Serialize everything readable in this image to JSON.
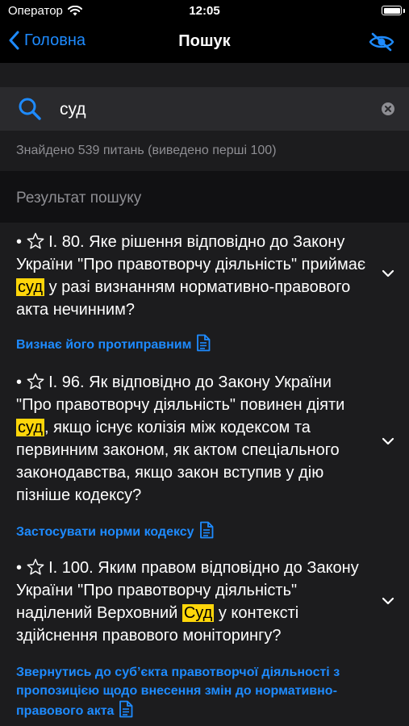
{
  "status": {
    "carrier": "Оператор",
    "time": "12:05"
  },
  "nav": {
    "back_label": "Головна",
    "title": "Пошук"
  },
  "search": {
    "value": "суд"
  },
  "info": {
    "found_text": "Знайдено 539 питань (виведено перші 100)"
  },
  "section": {
    "title": "Результат пошуку"
  },
  "colors": {
    "accent": "#1e8bff",
    "highlight": "#ffd60a",
    "background": "#1c1c1e"
  },
  "results": [
    {
      "prefix": "І. 80. Яке рішення відповідно до Закону України \"Про правотворчу діяльність\" приймає",
      "highlight": "суд",
      "suffix": "у разі визнанням нормативно-правового акта нечинним?",
      "answer": "Визнає його протиправним"
    },
    {
      "prefix": "І. 96. Як відповідно до Закону України \"Про правотворчу діяльність\" повинен діяти",
      "highlight": "суд",
      "suffix": ", якщо існує колізія між кодексом та первинним законом, як актом спеціального законодавства, якщо закон вступив у дію пізніше кодексу?",
      "answer": "Застосувати норми кодексу"
    },
    {
      "prefix": "І. 100. Яким правом відповідно до Закону України \"Про правотворчу діяльність\" наділений Верховний",
      "highlight": "Суд",
      "suffix": "у контексті здійснення правового моніторингу?",
      "answer": "Звернутись до суб’єкта правотворчої діяльності з пропозицією щодо внесення змін до нормативно-правового акта"
    }
  ]
}
